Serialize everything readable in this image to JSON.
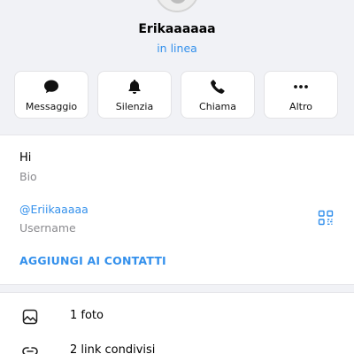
{
  "profile": {
    "name": "Erikaaaaaa",
    "status": "in linea"
  },
  "actions": [
    {
      "label": "Messaggio",
      "icon": "chat-bubble-icon"
    },
    {
      "label": "Silenzia",
      "icon": "bell-icon"
    },
    {
      "label": "Chiama",
      "icon": "phone-icon"
    },
    {
      "label": "Altro",
      "icon": "more-dots-icon"
    }
  ],
  "info": {
    "bio_text": "Hi",
    "bio_label": "Bio",
    "username": "@Eriikaaaaa",
    "username_label": "Username",
    "add_contacts": "AGGIUNGI AI CONTATTI"
  },
  "media": [
    {
      "label": "1 foto",
      "icon": "photo-icon"
    },
    {
      "label": "2 link condivisi",
      "icon": "link-icon"
    }
  ],
  "colors": {
    "accent": "#3390ec",
    "background": "#f1f2f6",
    "secondary_text": "#8a8a8e"
  }
}
